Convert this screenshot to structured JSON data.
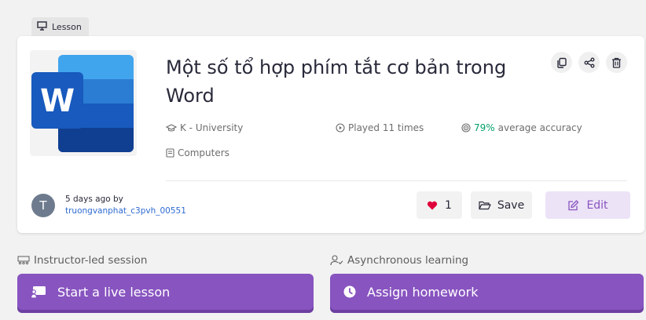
{
  "tag": {
    "label": "Lesson",
    "icon": "presentation-icon"
  },
  "lesson": {
    "title": "Một số tổ hợp phím tắt cơ bản trong Word",
    "grade": "K - University",
    "subject": "Computers",
    "played": "Played 11 times",
    "accuracy_value": "79%",
    "accuracy_label": "average accuracy",
    "thumbnail_letter": "W"
  },
  "author": {
    "avatar_letter": "T",
    "time_ago": "5 days ago by",
    "username": "truongvanphat_c3pvh_00551"
  },
  "buttons": {
    "like_count": "1",
    "save": "Save",
    "edit": "Edit"
  },
  "sections": {
    "instructor_label": "Instructor-led session",
    "async_label": "Asynchronous learning",
    "start_live": "Start a live lesson",
    "assign_homework": "Assign homework"
  },
  "colors": {
    "accent": "#8854c0",
    "accent_light": "#ece3f7",
    "accuracy": "#00a06a",
    "heart": "#e0003b",
    "link": "#2f6bd1"
  }
}
